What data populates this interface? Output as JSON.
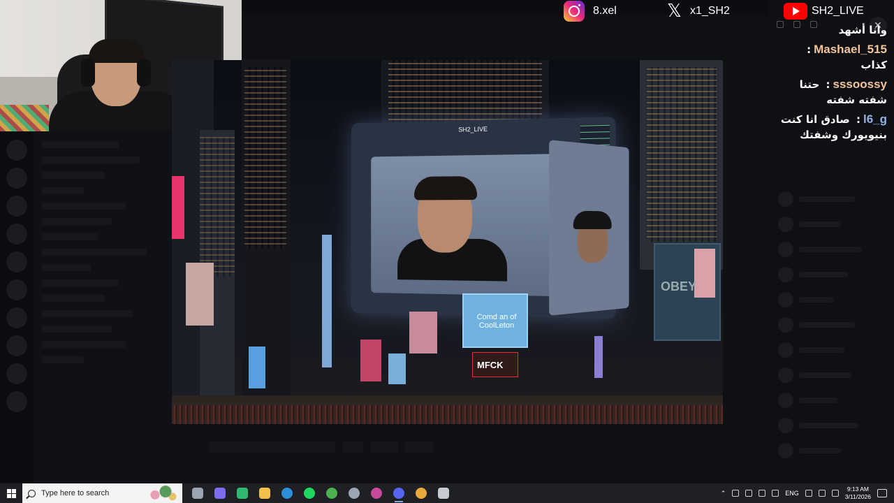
{
  "socials": {
    "instagram": "8.xel",
    "x": "x1_SH2",
    "youtube": "SH2_LIVE"
  },
  "chat": [
    {
      "user": "",
      "message": "وانا أشهد"
    },
    {
      "user": "Mashael_515",
      "message": "كذاب",
      "color": "#f2c49b"
    },
    {
      "user": "sssoossy",
      "message": "حتنا شفته شفته",
      "color": "#f2c49b"
    },
    {
      "user": "l6_g",
      "message": "صادق انا كنت بنيويورك وشفتك",
      "color": "#8fb4e8"
    }
  ],
  "viewer": {
    "screen_label": "SH2_LIVE",
    "ad_blue_text": "Comd an of CoolLeton",
    "ad_mfck_text": "MFCK",
    "ad_obey_text": "OBEY",
    "close_icon": "✕"
  },
  "taskbar": {
    "search_placeholder": "Type here to search",
    "lang": "ENG",
    "time": "9:13 AM",
    "date": "3/11/2026",
    "apps": [
      {
        "name": "task-view-icon",
        "color": "#9aa4b3",
        "active": false
      },
      {
        "name": "copilot-icon",
        "color": "#7b6cf0",
        "active": false
      },
      {
        "name": "play-store-icon",
        "color": "#2fb870",
        "active": false
      },
      {
        "name": "file-explorer-icon",
        "color": "#f2c14a",
        "active": false
      },
      {
        "name": "edge-icon",
        "color": "#2d8fd8",
        "active": false
      },
      {
        "name": "spotify-icon",
        "color": "#1ed760",
        "active": false
      },
      {
        "name": "xbox-icon",
        "color": "#4caf50",
        "active": false
      },
      {
        "name": "steam-icon",
        "color": "#9aa4b3",
        "active": false
      },
      {
        "name": "obs-icon",
        "color": "#c64a9a",
        "active": false
      },
      {
        "name": "discord-icon",
        "color": "#5865f2",
        "active": true
      },
      {
        "name": "chrome-icon",
        "color": "#e8a83a",
        "active": false
      },
      {
        "name": "settings-icon",
        "color": "#c8ccd2",
        "active": false
      }
    ]
  },
  "colors": {
    "accent": "#5865f2",
    "taskbar_bg": "#1f2024"
  }
}
